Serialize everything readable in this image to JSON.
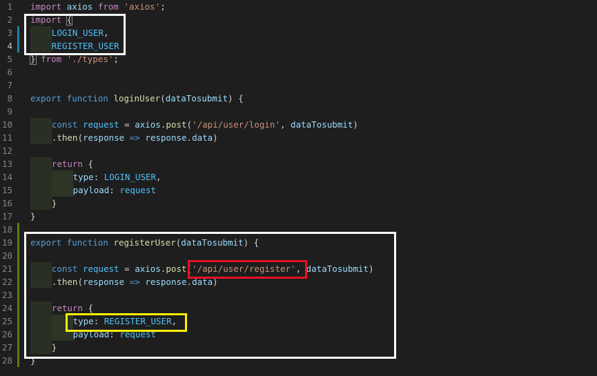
{
  "editor": {
    "lines": [
      {
        "n": "1",
        "segs": [
          {
            "k": "k",
            "t": "import"
          },
          {
            "k": "t",
            "t": " "
          },
          {
            "k": "v",
            "t": "axios"
          },
          {
            "k": "t",
            "t": " "
          },
          {
            "k": "k",
            "t": "from"
          },
          {
            "k": "t",
            "t": " "
          },
          {
            "k": "str",
            "t": "'axios'"
          },
          {
            "k": "t",
            "t": ";"
          }
        ]
      },
      {
        "n": "2",
        "segs": [
          {
            "k": "k",
            "t": "import"
          },
          {
            "k": "t",
            "t": " "
          },
          {
            "k": "t",
            "t": "{",
            "b": true
          }
        ]
      },
      {
        "n": "3",
        "indent": 1,
        "mark": "blue",
        "segs": [
          {
            "k": "c",
            "t": "LOGIN_USER"
          },
          {
            "k": "t",
            "t": ","
          }
        ]
      },
      {
        "n": "4",
        "indent": 1,
        "mark": "blue",
        "active": true,
        "segs": [
          {
            "k": "c",
            "t": "REGISTER_USER"
          }
        ]
      },
      {
        "n": "5",
        "segs": [
          {
            "k": "t",
            "t": "}",
            "b": true
          },
          {
            "k": "t",
            "t": " "
          },
          {
            "k": "k",
            "t": "from"
          },
          {
            "k": "t",
            "t": " "
          },
          {
            "k": "str",
            "t": "'./types'"
          },
          {
            "k": "t",
            "t": ";"
          }
        ]
      },
      {
        "n": "6",
        "segs": []
      },
      {
        "n": "7",
        "segs": []
      },
      {
        "n": "8",
        "segs": [
          {
            "k": "s",
            "t": "export"
          },
          {
            "k": "t",
            "t": " "
          },
          {
            "k": "s",
            "t": "function"
          },
          {
            "k": "t",
            "t": " "
          },
          {
            "k": "f",
            "t": "loginUser"
          },
          {
            "k": "t",
            "t": "("
          },
          {
            "k": "v",
            "t": "dataTosubmit"
          },
          {
            "k": "t",
            "t": ") {"
          }
        ]
      },
      {
        "n": "9",
        "segs": []
      },
      {
        "n": "10",
        "indent": 1,
        "segs": [
          {
            "k": "s",
            "t": "const"
          },
          {
            "k": "t",
            "t": " "
          },
          {
            "k": "c",
            "t": "request"
          },
          {
            "k": "t",
            "t": " = "
          },
          {
            "k": "v",
            "t": "axios"
          },
          {
            "k": "t",
            "t": "."
          },
          {
            "k": "f",
            "t": "post"
          },
          {
            "k": "t",
            "t": "("
          },
          {
            "k": "str",
            "t": "'/api/user/login'"
          },
          {
            "k": "t",
            "t": ", "
          },
          {
            "k": "v",
            "t": "dataTosubmit"
          },
          {
            "k": "t",
            "t": ")"
          }
        ]
      },
      {
        "n": "11",
        "indent": 1,
        "nopad": true,
        "segs": [
          {
            "k": "t",
            "t": "."
          },
          {
            "k": "f",
            "t": "then"
          },
          {
            "k": "t",
            "t": "("
          },
          {
            "k": "v",
            "t": "response"
          },
          {
            "k": "t",
            "t": " "
          },
          {
            "k": "s",
            "t": "=>"
          },
          {
            "k": "t",
            "t": " "
          },
          {
            "k": "v",
            "t": "response"
          },
          {
            "k": "t",
            "t": "."
          },
          {
            "k": "v",
            "t": "data"
          },
          {
            "k": "t",
            "t": ")"
          }
        ]
      },
      {
        "n": "12",
        "segs": []
      },
      {
        "n": "13",
        "indent": 1,
        "segs": [
          {
            "k": "k",
            "t": "return"
          },
          {
            "k": "t",
            "t": " {"
          }
        ]
      },
      {
        "n": "14",
        "indent": 2,
        "segs": [
          {
            "k": "v",
            "t": "type"
          },
          {
            "k": "t",
            "t": ": "
          },
          {
            "k": "c",
            "t": "LOGIN_USER"
          },
          {
            "k": "t",
            "t": ","
          }
        ]
      },
      {
        "n": "15",
        "indent": 2,
        "segs": [
          {
            "k": "v",
            "t": "payload"
          },
          {
            "k": "t",
            "t": ": "
          },
          {
            "k": "c",
            "t": "request"
          }
        ]
      },
      {
        "n": "16",
        "indent": 1,
        "segs": [
          {
            "k": "t",
            "t": "}"
          }
        ]
      },
      {
        "n": "17",
        "segs": [
          {
            "k": "t",
            "t": "}"
          }
        ]
      },
      {
        "n": "18",
        "mark": "green",
        "segs": []
      },
      {
        "n": "19",
        "mark": "green",
        "segs": [
          {
            "k": "s",
            "t": "export"
          },
          {
            "k": "t",
            "t": " "
          },
          {
            "k": "s",
            "t": "function"
          },
          {
            "k": "t",
            "t": " "
          },
          {
            "k": "f",
            "t": "registerUser"
          },
          {
            "k": "t",
            "t": "("
          },
          {
            "k": "v",
            "t": "dataTosubmit"
          },
          {
            "k": "t",
            "t": ") {"
          }
        ]
      },
      {
        "n": "20",
        "mark": "green",
        "segs": []
      },
      {
        "n": "21",
        "indent": 1,
        "mark": "green",
        "segs": [
          {
            "k": "s",
            "t": "const"
          },
          {
            "k": "t",
            "t": " "
          },
          {
            "k": "c",
            "t": "request"
          },
          {
            "k": "t",
            "t": " = "
          },
          {
            "k": "v",
            "t": "axios"
          },
          {
            "k": "t",
            "t": "."
          },
          {
            "k": "f",
            "t": "post"
          },
          {
            "k": "t",
            "t": "("
          },
          {
            "k": "str",
            "t": "'/api/user/register'"
          },
          {
            "k": "t",
            "t": ", "
          },
          {
            "k": "v",
            "t": "dataTosubmit"
          },
          {
            "k": "t",
            "t": ")"
          }
        ]
      },
      {
        "n": "22",
        "indent": 1,
        "mark": "green",
        "nopad": true,
        "segs": [
          {
            "k": "t",
            "t": "."
          },
          {
            "k": "f",
            "t": "then"
          },
          {
            "k": "t",
            "t": "("
          },
          {
            "k": "v",
            "t": "response"
          },
          {
            "k": "t",
            "t": " "
          },
          {
            "k": "s",
            "t": "=>"
          },
          {
            "k": "t",
            "t": " "
          },
          {
            "k": "v",
            "t": "response"
          },
          {
            "k": "t",
            "t": "."
          },
          {
            "k": "v",
            "t": "data"
          },
          {
            "k": "t",
            "t": ")"
          }
        ]
      },
      {
        "n": "23",
        "mark": "green",
        "segs": []
      },
      {
        "n": "24",
        "indent": 1,
        "mark": "green",
        "segs": [
          {
            "k": "k",
            "t": "return"
          },
          {
            "k": "t",
            "t": " {"
          }
        ]
      },
      {
        "n": "25",
        "indent": 2,
        "mark": "green",
        "segs": [
          {
            "k": "v",
            "t": "type"
          },
          {
            "k": "t",
            "t": ": "
          },
          {
            "k": "c",
            "t": "REGISTER_USER"
          },
          {
            "k": "t",
            "t": ","
          }
        ]
      },
      {
        "n": "26",
        "indent": 2,
        "mark": "green",
        "segs": [
          {
            "k": "v",
            "t": "payload"
          },
          {
            "k": "t",
            "t": ": "
          },
          {
            "k": "c",
            "t": "request"
          }
        ]
      },
      {
        "n": "27",
        "indent": 1,
        "mark": "green",
        "segs": [
          {
            "k": "t",
            "t": "}"
          }
        ]
      },
      {
        "n": "28",
        "mark": "green",
        "segs": [
          {
            "k": "t",
            "t": "}"
          }
        ]
      }
    ]
  },
  "annotations": {
    "box_colors": {
      "white": "#ffffff",
      "red": "#e81123",
      "yellow": "#fff200"
    }
  },
  "colors": {
    "background": "#1e1e1e",
    "keyword_control": "#c586c0",
    "keyword_storage": "#569cd6",
    "function_name": "#dcdcaa",
    "variable": "#9cdcfe",
    "constant": "#4fc1ff",
    "string": "#ce9178",
    "gutter_text": "#858585",
    "change_marker_blue": "#1b81a8",
    "change_marker_green": "#587c0c"
  }
}
